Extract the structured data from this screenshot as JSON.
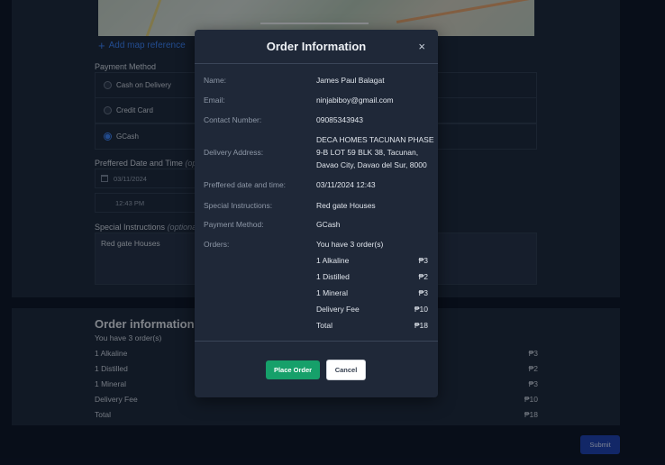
{
  "background": {
    "add_map_label": "Add map reference",
    "payment_method_label": "Payment Method",
    "payment_options": [
      "Cash on Delivery",
      "Credit Card",
      "GCash"
    ],
    "selected_payment": "GCash",
    "date_label": "Preffered Date and Time",
    "date_label_optional": "(opt",
    "date_value": "03/11/2024",
    "time_value": "12:43 PM",
    "instructions_label": "Special Instructions",
    "instructions_optional": "(optional)",
    "instructions_value": "Red gate Houses",
    "order_info_title": "Order information",
    "order_count": "You have 3 order(s)",
    "orders": [
      {
        "name": "1 Alkaline",
        "price": "₱3"
      },
      {
        "name": "1 Distilled",
        "price": "₱2"
      },
      {
        "name": "1 Mineral",
        "price": "₱3"
      },
      {
        "name": "Delivery Fee",
        "price": "₱10"
      },
      {
        "name": "Total",
        "price": "₱18"
      }
    ],
    "submit_label": "Submit"
  },
  "modal": {
    "title": "Order Information",
    "close_symbol": "×",
    "labels": {
      "name": "Name:",
      "email": "Email:",
      "contact": "Contact Number:",
      "address": "Delivery Address:",
      "datetime": "Preffered date and time:",
      "instructions": "Special Instructions:",
      "payment": "Payment Method:",
      "orders": "Orders:"
    },
    "values": {
      "name": "James Paul Balagat",
      "email": "ninjabiboy@gmail.com",
      "contact": "09085343943",
      "address_line1": "DECA HOMES TACUNAN PHASE",
      "address_line2": "9-B LOT 59 BLK 38, Tacunan,",
      "address_line3": "Davao City, Davao del Sur, 8000",
      "datetime": "03/11/2024 12:43",
      "instructions": "Red gate Houses",
      "payment": "GCash",
      "order_count": "You have 3 order(s)"
    },
    "orders": [
      {
        "name": "1 Alkaline",
        "price": "₱3"
      },
      {
        "name": "1 Distilled",
        "price": "₱2"
      },
      {
        "name": "1 Mineral",
        "price": "₱3"
      },
      {
        "name": "Delivery Fee",
        "price": "₱10"
      },
      {
        "name": "Total",
        "price": "₱18"
      }
    ],
    "place_order_label": "Place Order",
    "cancel_label": "Cancel"
  },
  "colors": {
    "page_bg": "#0b1322",
    "card_bg": "#1d2737",
    "modal_bg": "#1f2838",
    "accent_blue": "#3b82f6",
    "place_order_green": "#16a06a",
    "submit_blue": "#1e40af"
  }
}
